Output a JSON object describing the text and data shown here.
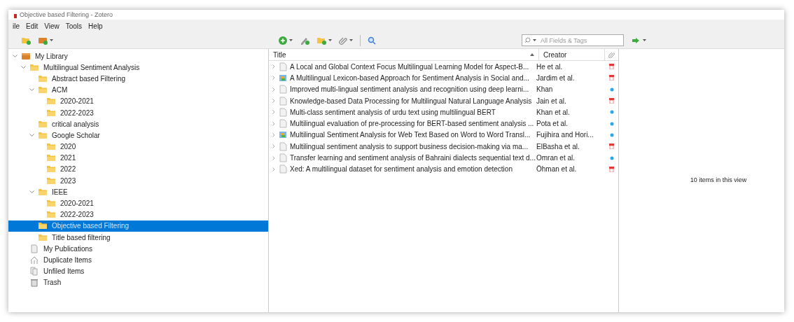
{
  "window": {
    "title": "Objective based Filtering - Zotero"
  },
  "menu": [
    "ile",
    "Edit",
    "View",
    "Tools",
    "Help"
  ],
  "search": {
    "placeholder": "All Fields & Tags"
  },
  "collections": [
    {
      "kind": "library",
      "label": "My Library",
      "expanded": true,
      "selected": false,
      "children": [
        {
          "kind": "folder",
          "label": "Multilingual Sentiment Analysis",
          "expanded": true,
          "selected": false,
          "children": [
            {
              "kind": "folder",
              "label": "Abstract based Filtering",
              "selected": false
            },
            {
              "kind": "folder",
              "label": "ACM",
              "expanded": true,
              "selected": false,
              "children": [
                {
                  "kind": "folder",
                  "label": "2020-2021",
                  "selected": false
                },
                {
                  "kind": "folder",
                  "label": "2022-2023",
                  "selected": false
                }
              ]
            },
            {
              "kind": "folder",
              "label": "critical analysis",
              "selected": false
            },
            {
              "kind": "folder",
              "label": "Google Scholar",
              "expanded": true,
              "selected": false,
              "children": [
                {
                  "kind": "folder",
                  "label": "2020",
                  "selected": false
                },
                {
                  "kind": "folder",
                  "label": "2021",
                  "selected": false
                },
                {
                  "kind": "folder",
                  "label": "2022",
                  "selected": false
                },
                {
                  "kind": "folder",
                  "label": "2023",
                  "selected": false
                }
              ]
            },
            {
              "kind": "folder",
              "label": "IEEE",
              "expanded": true,
              "selected": false,
              "children": [
                {
                  "kind": "folder",
                  "label": "2020-2021",
                  "selected": false
                },
                {
                  "kind": "folder",
                  "label": "2022-2023",
                  "selected": false
                }
              ]
            },
            {
              "kind": "folder",
              "label": "Objective based Filtering",
              "selected": true
            },
            {
              "kind": "folder",
              "label": "Title based filtering",
              "selected": false
            }
          ]
        },
        {
          "kind": "publications",
          "label": "My Publications",
          "selected": false
        },
        {
          "kind": "duplicates",
          "label": "Duplicate Items",
          "selected": false
        },
        {
          "kind": "unfiled",
          "label": "Unfiled Items",
          "selected": false
        },
        {
          "kind": "trash",
          "label": "Trash",
          "selected": false
        }
      ]
    }
  ],
  "table": {
    "columns": [
      "Title",
      "Creator"
    ],
    "rows": [
      {
        "kind": "paper",
        "title": "A Local and Global Context Focus Multilingual Learning Model for Aspect-B...",
        "creator": "He et al.",
        "has_pdf": true
      },
      {
        "kind": "webpage",
        "title": "A Multilingual Lexicon-based Approach for Sentiment Analysis in Social and...",
        "creator": "Jardim et al.",
        "has_pdf": true
      },
      {
        "kind": "paper",
        "title": "Improved multi-lingual sentiment analysis and recognition using deep learni...",
        "creator": "Khan",
        "has_pdf": false
      },
      {
        "kind": "paper",
        "title": "Knowledge-based Data Processing for Multilingual Natural Language Analysis",
        "creator": "Jain et al.",
        "has_pdf": true
      },
      {
        "kind": "paper",
        "title": "Multi-class sentiment analysis of urdu text using multilingual BERT",
        "creator": "Khan et al.",
        "has_pdf": false
      },
      {
        "kind": "paper",
        "title": "Multilingual evaluation of pre-processing for BERT-based sentiment analysis ...",
        "creator": "Pota et al.",
        "has_pdf": false
      },
      {
        "kind": "webpage",
        "title": "Multilingual Sentiment Analysis for Web Text Based on Word to Word Transl...",
        "creator": "Fujihira and Hori...",
        "has_pdf": false
      },
      {
        "kind": "paper",
        "title": "Multilingual sentiment analysis to support business decision-making via ma...",
        "creator": "ElBasha et al.",
        "has_pdf": true
      },
      {
        "kind": "paper",
        "title": "Transfer learning and sentiment analysis of Bahraini dialects sequential text d...",
        "creator": "Omran et al.",
        "has_pdf": false
      },
      {
        "kind": "paper",
        "title": "Xed: A multilingual dataset for sentiment analysis and emotion detection",
        "creator": "Öhman et al.",
        "has_pdf": true
      }
    ]
  },
  "item_count": "10 items in this view"
}
